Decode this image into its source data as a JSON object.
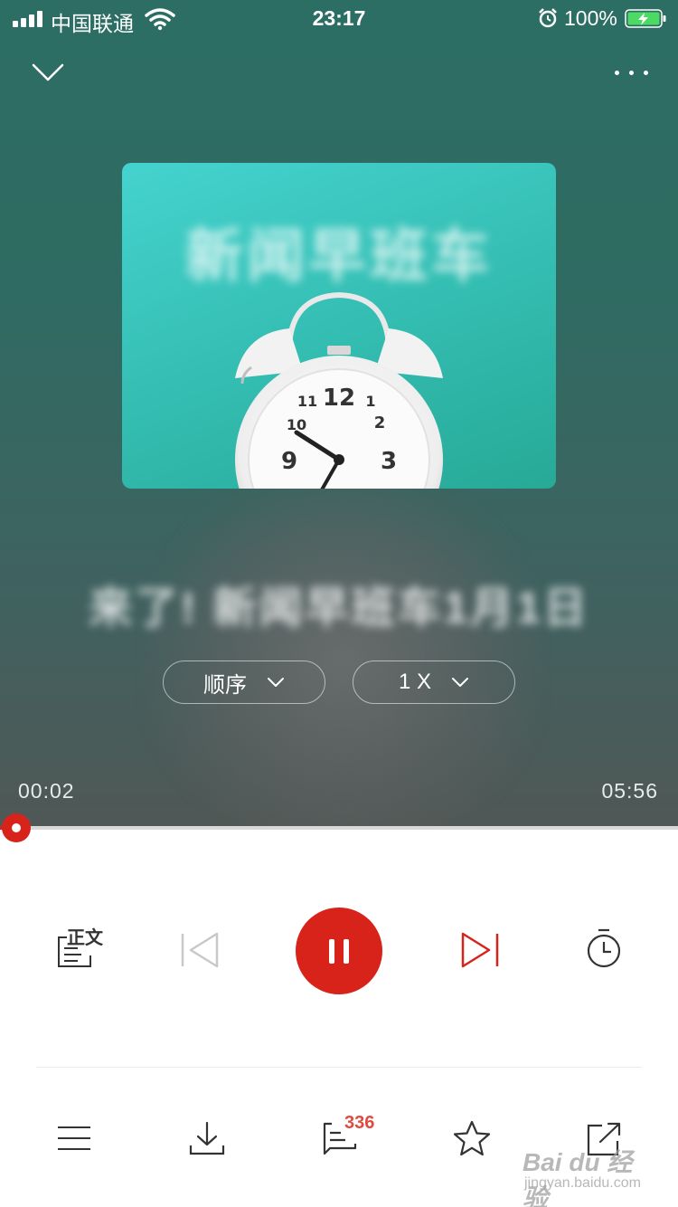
{
  "status_bar": {
    "carrier": "中国联通",
    "time": "23:17",
    "battery_percent": "100%"
  },
  "player": {
    "cover_title": "新闻早班车",
    "episode_title": "来了! 新闻早班车1月1日",
    "order_mode": "顺序",
    "speed": "1 X",
    "current_time": "00:02",
    "total_time": "05:56",
    "progress_fraction": 0.006
  },
  "controls": {
    "text_label": "正文"
  },
  "bottom_bar": {
    "comment_count": "336"
  },
  "watermark": {
    "main": "Bai du 经验",
    "sub": "jingyan.baidu.com"
  },
  "colors": {
    "accent_red": "#d8231a",
    "comment_badge": "#e04a3f"
  }
}
